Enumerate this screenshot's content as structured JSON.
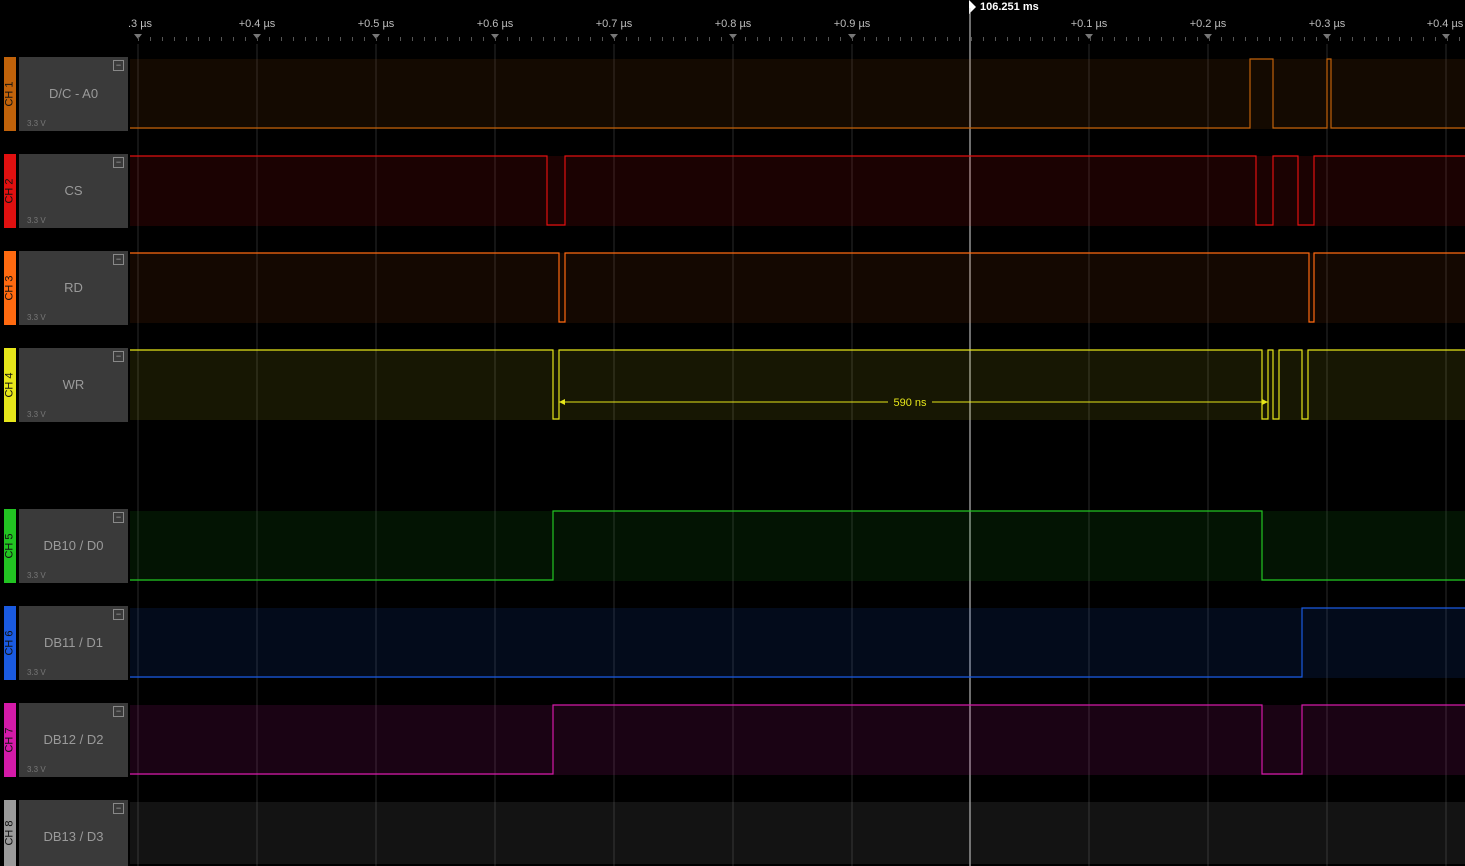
{
  "ruler": {
    "labels": [
      ".3 µs",
      "+0.4 µs",
      "+0.5 µs",
      "+0.6 µs",
      "+0.7 µs",
      "+0.8 µs",
      "+0.9 µs",
      "+0.1 µs",
      "+0.2 µs",
      "+0.3 µs",
      "+0.4 µs"
    ],
    "cursor_label": "106.251 ms"
  },
  "channels": [
    {
      "id": "CH 1",
      "name": "D/C - A0",
      "voltage": "3.3 V",
      "color": "#c0620a"
    },
    {
      "id": "CH 2",
      "name": "CS",
      "voltage": "3.3 V",
      "color": "#e01010"
    },
    {
      "id": "CH 3",
      "name": "RD",
      "voltage": "3.3 V",
      "color": "#ff6a10"
    },
    {
      "id": "CH 4",
      "name": "WR",
      "voltage": "3.3 V",
      "color": "#e6e61a"
    },
    {
      "id": "CH 5",
      "name": "DB10 / D0",
      "voltage": "3.3 V",
      "color": "#22c422"
    },
    {
      "id": "CH 6",
      "name": "DB11 / D1",
      "voltage": "3.3 V",
      "color": "#1a5ae0"
    },
    {
      "id": "CH 7",
      "name": "DB12 / D2",
      "voltage": "3.3 V",
      "color": "#d41aa8"
    },
    {
      "id": "CH 8",
      "name": "DB13 / D3",
      "voltage": "",
      "color": "#9a9a9a"
    }
  ],
  "measurement": {
    "label": "590 ns"
  },
  "collapse_glyph": "−"
}
